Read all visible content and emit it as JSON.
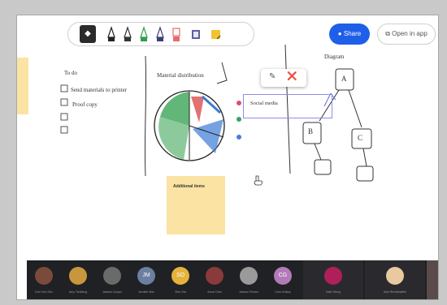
{
  "toolbar": {
    "select_icon": "cursor-icon",
    "pen_colors": [
      "#222222",
      "#333333",
      "#2e9e4b",
      "#3a3f7a",
      "#e86a6a"
    ],
    "highlighter_color": "#5d5fa7",
    "note_color": "#f2c230"
  },
  "header": {
    "share_label": "Share",
    "open_in_app_label": "Open in app",
    "accent_color": "#1f5ee8"
  },
  "board": {
    "todo_title": "To do",
    "todo_items": [
      "Send materials to printer",
      "Proof copy",
      "",
      ""
    ],
    "chart_title": "Material distribution",
    "chart_slice_colors": [
      "#2e9e4b",
      "#d94f4f",
      "#3a7bd5",
      "#333333"
    ],
    "diagram_title": "Diagram",
    "diagram_nodes": [
      "A",
      "B",
      "C",
      "",
      ""
    ],
    "sticky_note_text": "Additional items",
    "textbox_text": "Social media",
    "legend_dot_colors": [
      "#d94f6f",
      "#37a36b",
      "#4d7ae0"
    ],
    "sticky_color": "#fbe3a4"
  },
  "participants": [
    {
      "name": "Kat Yuen Sim",
      "initials": "",
      "color": "#7a4a3a"
    },
    {
      "name": "Amy Tambling",
      "initials": "",
      "color": "#c8963c"
    },
    {
      "name": "Jessica Cooper",
      "initials": "",
      "color": "#6a6a6a"
    },
    {
      "name": "Jennifer Mok",
      "initials": "JM",
      "color": "#6b7fa0"
    },
    {
      "name": "Shin Ota",
      "initials": "SO",
      "color": "#e3b33b"
    },
    {
      "name": "Anna Chan",
      "initials": "",
      "color": "#8a3a3a"
    },
    {
      "name": "Jessica Ferraro",
      "initials": "",
      "color": "#9a9a9a"
    },
    {
      "name": "Cara Grisley",
      "initials": "CG",
      "color": "#b27ab8"
    },
    {
      "name": "Kathi Wong",
      "initials": "",
      "color": "#b01f5a"
    },
    {
      "name": "Alan Rechtshaffen",
      "initials": "",
      "color": "#e8c9a0"
    }
  ]
}
